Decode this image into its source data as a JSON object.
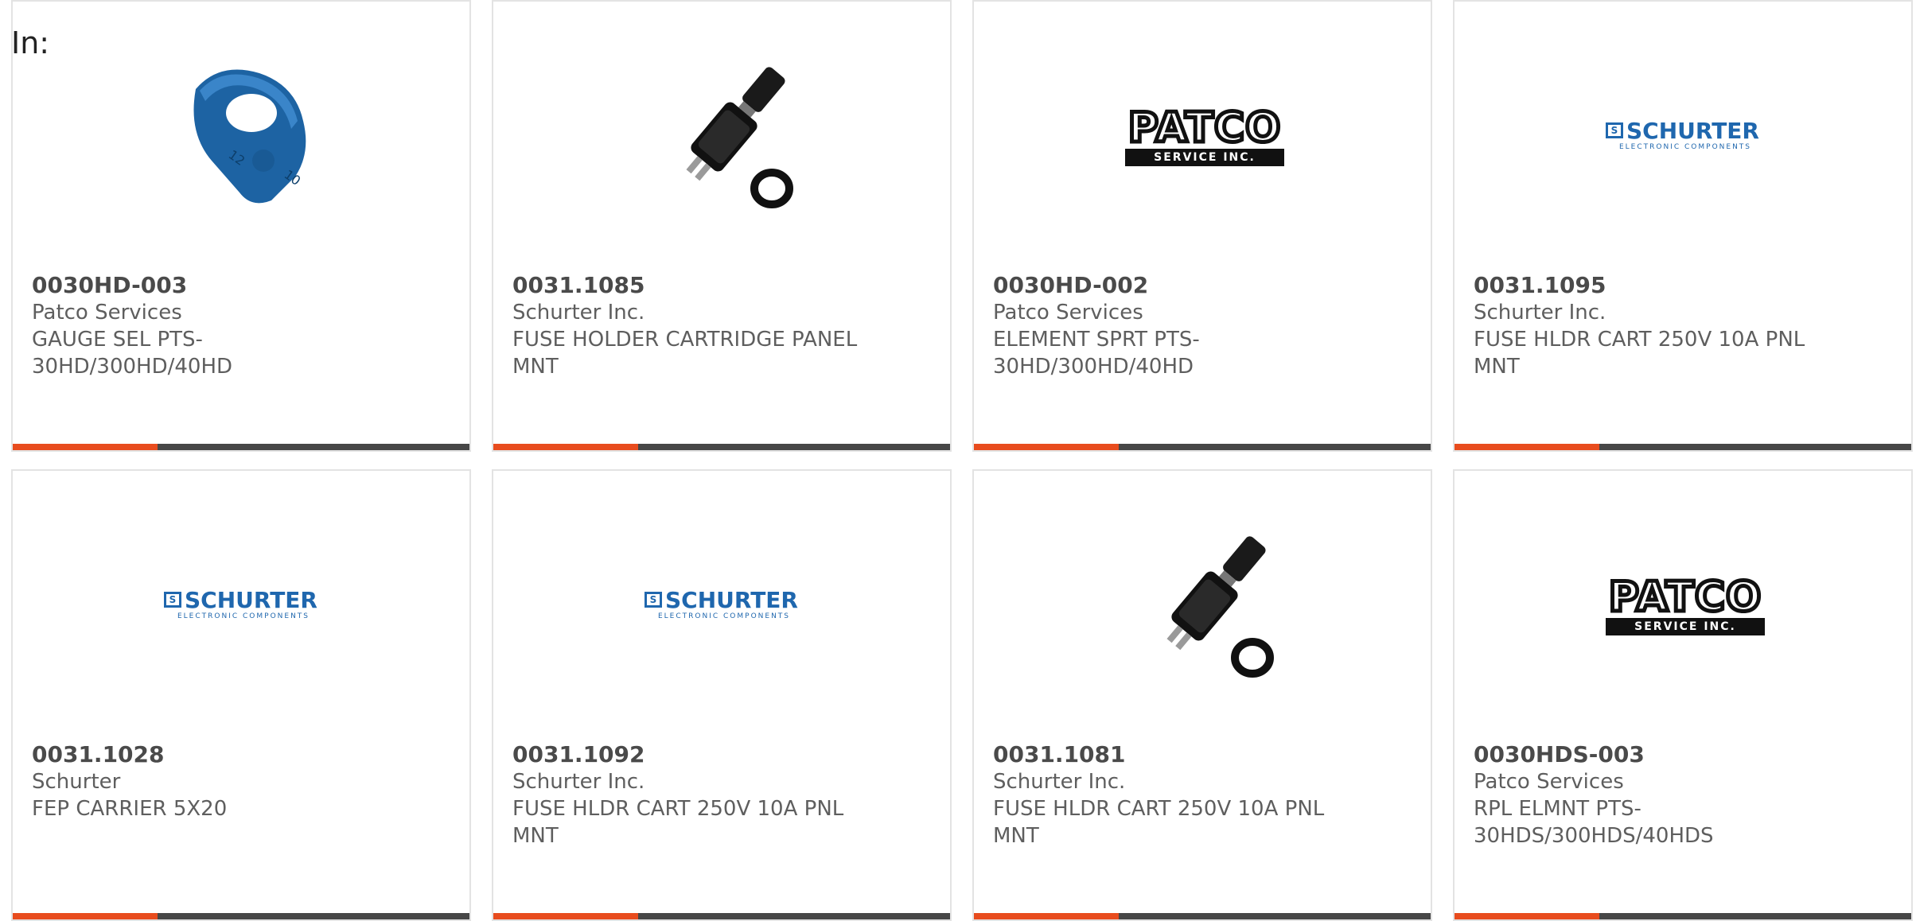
{
  "page": {
    "prefix_label": "In:"
  },
  "colors": {
    "accent": "#e84c1e",
    "bar_dark": "#474747",
    "schurter_blue": "#1f67ae"
  },
  "products": [
    {
      "part_number": "0030HD-003",
      "manufacturer": "Patco Services",
      "description": "GAUGE SEL PTS-30HD/300HD/40HD",
      "image": "blue-gauge-selector-photo"
    },
    {
      "part_number": "0031.1085",
      "manufacturer": "Schurter Inc.",
      "description": "FUSE HOLDER CARTRIDGE PANEL MNT",
      "image": "fuse-holder-photo"
    },
    {
      "part_number": "0030HD-002",
      "manufacturer": "Patco Services",
      "description": "ELEMENT SPRT PTS-30HD/300HD/40HD",
      "image": "patco-logo"
    },
    {
      "part_number": "0031.1095",
      "manufacturer": "Schurter Inc.",
      "description": "FUSE HLDR CART 250V 10A PNL MNT",
      "image": "schurter-logo"
    },
    {
      "part_number": "0031.1028",
      "manufacturer": "Schurter",
      "description": "FEP CARRIER 5X20",
      "image": "schurter-logo"
    },
    {
      "part_number": "0031.1092",
      "manufacturer": "Schurter Inc.",
      "description": "FUSE HLDR CART 250V 10A PNL MNT",
      "image": "schurter-logo"
    },
    {
      "part_number": "0031.1081",
      "manufacturer": "Schurter Inc.",
      "description": "FUSE HLDR CART 250V 10A PNL MNT",
      "image": "fuse-holder-photo"
    },
    {
      "part_number": "0030HDS-003",
      "manufacturer": "Patco Services",
      "description": "RPL ELMNT PTS-30HDS/300HDS/40HDS",
      "image": "patco-logo"
    }
  ],
  "logos": {
    "patco_word": "PATCO",
    "patco_band": "SERVICE INC.",
    "schurter_mark": "S",
    "schurter_name": "SCHURTER",
    "schurter_sub": "ELECTRONIC COMPONENTS"
  }
}
